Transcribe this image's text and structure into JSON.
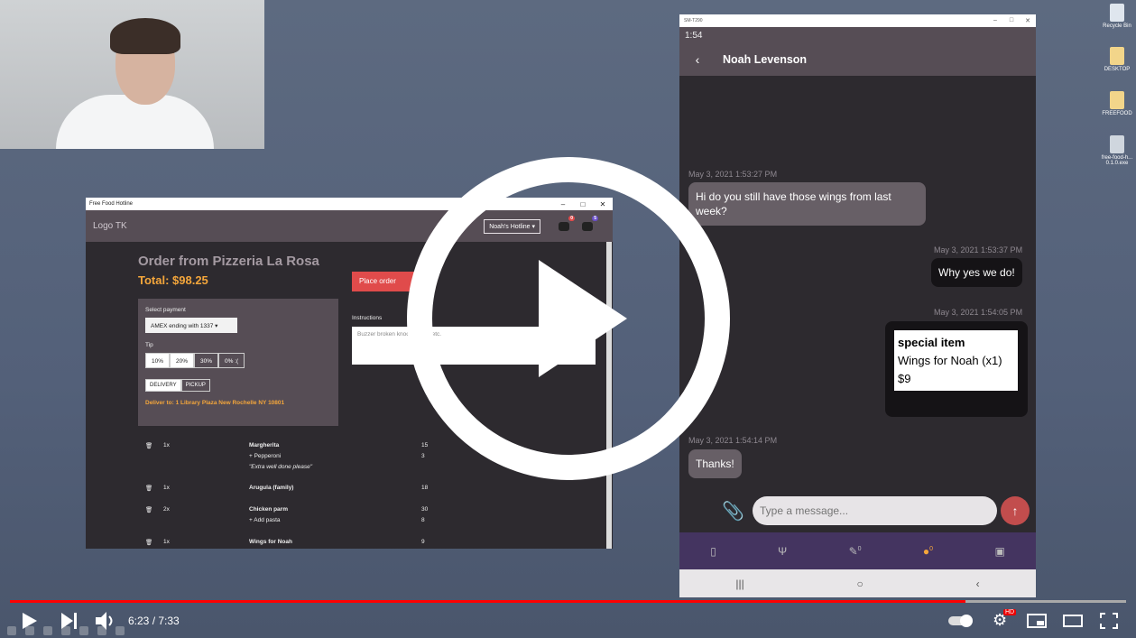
{
  "desktop": {
    "icons": [
      {
        "label": "Recycle Bin",
        "icon": "recycle-bin-icon"
      },
      {
        "label": "DESKTOP",
        "icon": "folder-icon"
      },
      {
        "label": "FREEFOOD",
        "icon": "folder-icon"
      },
      {
        "label": "free-food-h... 0.1.0.exe",
        "icon": "app-exe-icon"
      }
    ]
  },
  "app": {
    "window_title": "Free Food Hotline",
    "logo": "Logo TK",
    "hotline_selector": "Noah's Hotline ▾",
    "chat_badge": "0",
    "bag_badge": "5",
    "order_title": "Order from Pizzeria La Rosa",
    "total": "Total: $98.25",
    "place_order": "Place order",
    "payment": {
      "label": "Select payment",
      "selected": "AMEX ending with 1337 ▾",
      "tip_label": "Tip",
      "tips": [
        "10%",
        "20%",
        "30%",
        "0% :("
      ],
      "modes": [
        "DELIVERY",
        "PICKUP"
      ],
      "deliver_to": "Deliver to: 1 Library Plaza New Rochelle NY 10801"
    },
    "instructions": {
      "label": "Instructions",
      "value": "Buzzer broken knock loudly, etc."
    },
    "items": [
      {
        "qty": "1x",
        "name": "Margherita",
        "price": "15",
        "extras": [
          {
            "text": "+ Pepperoni",
            "price": "3"
          }
        ],
        "note": "\"Extra well done please\""
      },
      {
        "qty": "1x",
        "name": "Arugula (family)",
        "price": "18",
        "extras": [],
        "note": ""
      },
      {
        "qty": "2x",
        "name": "Chicken parm",
        "price": "30",
        "extras": [
          {
            "text": "+ Add pasta",
            "price": "8"
          }
        ],
        "note": ""
      },
      {
        "qty": "1x",
        "name": "Wings for Noah",
        "price": "9",
        "extras": [],
        "note": ""
      }
    ]
  },
  "phone": {
    "window_title": "SM-T290",
    "clock": "1:54",
    "contact": "Noah Levenson",
    "messages": [
      {
        "time": "May 3, 2021 1:53:27 PM",
        "text": "Hi do you still have those wings from last week?",
        "dir": "in"
      },
      {
        "time": "May 3, 2021 1:53:37 PM",
        "text": "Why yes we do!",
        "dir": "out"
      },
      {
        "time": "May 3, 2021 1:54:05 PM",
        "special_title": "special item",
        "special_line1": "Wings for Noah (x1)",
        "special_line2": "$9",
        "dir": "out"
      },
      {
        "time": "May 3, 2021 1:54:14 PM",
        "text": "Thanks!",
        "dir": "in"
      }
    ],
    "input_placeholder": "Type a message...",
    "tabs": [
      {
        "icon": "phone-icon",
        "count": ""
      },
      {
        "icon": "fork-knife-icon",
        "count": ""
      },
      {
        "icon": "pencil-icon",
        "count": "0"
      },
      {
        "icon": "chat-icon",
        "count": "0"
      },
      {
        "icon": "terminal-icon",
        "count": ""
      }
    ],
    "tab_active_color": "#f4a63b"
  },
  "player": {
    "time": "6:23 / 7:33",
    "progress": 0.856,
    "hd_badge": "HD"
  }
}
